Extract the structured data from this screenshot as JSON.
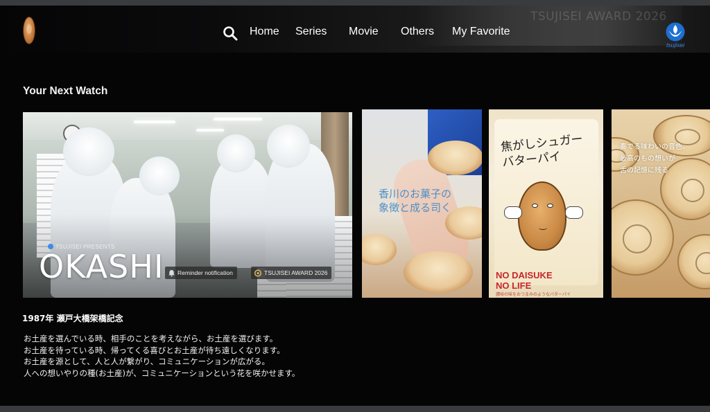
{
  "header": {
    "watermark": "TSUJISEI AWARD 2026",
    "nav": [
      "Home",
      "Series",
      "Movie",
      "Others",
      "My Favorite"
    ],
    "brand_text": "tsujisei"
  },
  "section": {
    "title": "Your Next Watch"
  },
  "hero": {
    "presents": "TSUJISEI PRESENTS",
    "title": "OKASHI",
    "chips": [
      "Reminder notification",
      "TSUJISEI AWARD 2026"
    ]
  },
  "thumbnails": [
    {
      "text": [
        "香川のお菓子の",
        "象徴と成る司く"
      ]
    },
    {
      "script": [
        "焦がしシュガー",
        "バターパイ"
      ],
      "text": [
        "NO DAISUKE",
        "NO LIFE"
      ],
      "sub": "讃岐の味をおつまみのようなバターパイ"
    },
    {
      "text": [
        "奏でる味わいの音色。",
        "最高のもの想いが",
        "舌の記憶に残る"
      ]
    }
  ],
  "description": {
    "title": "1987年 瀬戸大橋架橋記念",
    "lines": [
      "お土産を選んでいる時、相手のことを考えながら、お土産を選びます。",
      "お土産を待っている時、帰ってくる喜びとお土産が待ち遠しくなります。",
      "お土産を源として、人と人が繋がり、コミュニケーションが広がる。",
      "人への想いやりの種(お土産)が、コミュニケーションという花を咲かせます。"
    ]
  },
  "colors": {
    "background": "#050506",
    "accent_blue": "#1e6fd0",
    "red_text": "#c8252b"
  },
  "icons": [
    "cookie-logo-icon",
    "search-icon",
    "tsujisei-emblem-icon",
    "bell-icon",
    "award-icon"
  ]
}
